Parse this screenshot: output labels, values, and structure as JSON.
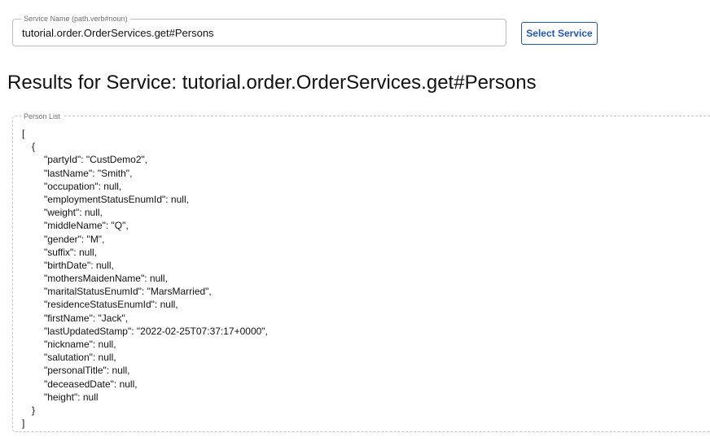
{
  "service_field": {
    "label": "Service Name (path.verb#noun)",
    "value": "tutorial.order.OrderServices.get#Persons"
  },
  "select_button": {
    "label": "Select Service"
  },
  "results": {
    "heading": "Results for Service: tutorial.order.OrderServices.get#Persons"
  },
  "person_list": {
    "label": "Person List",
    "open_bracket": "[",
    "open_brace": "{",
    "fields": [
      "\"partyId\": \"CustDemo2\",",
      "\"lastName\": \"Smith\",",
      "\"occupation\": null,",
      "\"employmentStatusEnumId\": null,",
      "\"weight\": null,",
      "\"middleName\": \"Q\",",
      "\"gender\": \"M\",",
      "\"suffix\": null,",
      "\"birthDate\": null,",
      "\"mothersMaidenName\": null,",
      "\"maritalStatusEnumId\": \"MarsMarried\",",
      "\"residenceStatusEnumId\": null,",
      "\"firstName\": \"Jack\",",
      "\"lastUpdatedStamp\": \"2022-02-25T07:37:17+0000\",",
      "\"nickname\": null,",
      "\"salutation\": null,",
      "\"personalTitle\": null,",
      "\"deceasedDate\": null,",
      "\"height\": null"
    ],
    "close_brace": "}",
    "close_bracket": "]"
  }
}
